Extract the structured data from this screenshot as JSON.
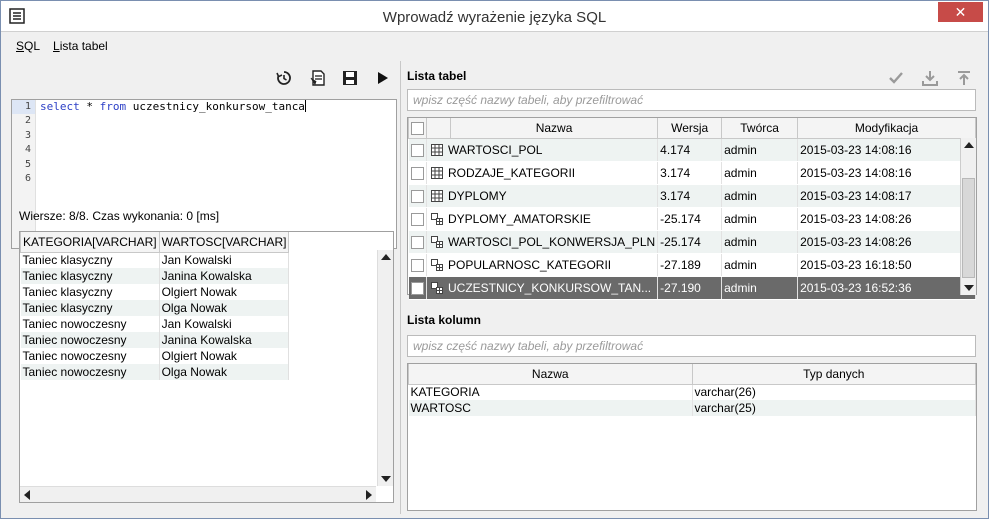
{
  "window": {
    "title": "Wprowadź wyrażenie języka SQL",
    "close_glyph": "✕"
  },
  "menu": {
    "items": [
      {
        "label": "SQL",
        "mnemonic": "S"
      },
      {
        "label": "Lista tabel",
        "mnemonic": "L"
      }
    ]
  },
  "editor": {
    "line_numbers": [
      "1",
      "2",
      "3",
      "4",
      "5",
      "6"
    ],
    "code": {
      "kw1": "select",
      "star": " * ",
      "kw2": "from",
      "rest": " uczestnicy_konkursow_tanca"
    }
  },
  "results": {
    "status": "Wiersze: 8/8. Czas wykonania: 0 [ms]",
    "columns": [
      "KATEGORIA[VARCHAR]",
      "WARTOSC[VARCHAR]"
    ],
    "rows": [
      [
        "Taniec klasyczny",
        "Jan Kowalski"
      ],
      [
        "Taniec klasyczny",
        "Janina Kowalska"
      ],
      [
        "Taniec klasyczny",
        "Olgiert Nowak"
      ],
      [
        "Taniec klasyczny",
        "Olga Nowak"
      ],
      [
        "Taniec nowoczesny",
        "Jan Kowalski"
      ],
      [
        "Taniec nowoczesny",
        "Janina Kowalska"
      ],
      [
        "Taniec nowoczesny",
        "Olgiert Nowak"
      ],
      [
        "Taniec nowoczesny",
        "Olga Nowak"
      ]
    ]
  },
  "tables_panel": {
    "title": "Lista tabel",
    "filter_placeholder": "wpisz część nazwy tabeli, aby przefiltrować",
    "columns": [
      "Nazwa",
      "Wersja",
      "Twórca",
      "Modyfikacja"
    ],
    "rows": [
      {
        "icon": "table-icon",
        "name": "WARTOSCI_POL",
        "version": "4.174",
        "author": "admin",
        "modified": "2015-03-23 14:08:16",
        "selected": false
      },
      {
        "icon": "table-icon",
        "name": "RODZAJE_KATEGORII",
        "version": "3.174",
        "author": "admin",
        "modified": "2015-03-23 14:08:16",
        "selected": false
      },
      {
        "icon": "table-icon",
        "name": "DYPLOMY",
        "version": "3.174",
        "author": "admin",
        "modified": "2015-03-23 14:08:17",
        "selected": false
      },
      {
        "icon": "view-icon",
        "name": "DYPLOMY_AMATORSKIE",
        "version": "-25.174",
        "author": "admin",
        "modified": "2015-03-23 14:08:26",
        "selected": false
      },
      {
        "icon": "view-icon",
        "name": "WARTOSCI_POL_KONWERSJA_PLN",
        "version": "-25.174",
        "author": "admin",
        "modified": "2015-03-23 14:08:26",
        "selected": false
      },
      {
        "icon": "view-icon",
        "name": "POPULARNOSC_KATEGORII",
        "version": "-27.189",
        "author": "admin",
        "modified": "2015-03-23 16:18:50",
        "selected": false
      },
      {
        "icon": "view-icon",
        "name": "UCZESTNICY_KONKURSOW_TAN...",
        "version": "-27.190",
        "author": "admin",
        "modified": "2015-03-23 16:52:36",
        "selected": true
      }
    ]
  },
  "columns_panel": {
    "title": "Lista kolumn",
    "filter_placeholder": "wpisz część nazwy tabeli, aby przefiltrować",
    "columns": [
      "Nazwa",
      "Typ danych"
    ],
    "rows": [
      [
        "KATEGORIA",
        "varchar(26)"
      ],
      [
        "WARTOSC",
        "varchar(25)"
      ]
    ]
  },
  "colors": {
    "accent": "#2c3fc6",
    "selected_row": "#6a6a6a",
    "alt_row": "#eef3f2",
    "close": "#c74b48"
  }
}
